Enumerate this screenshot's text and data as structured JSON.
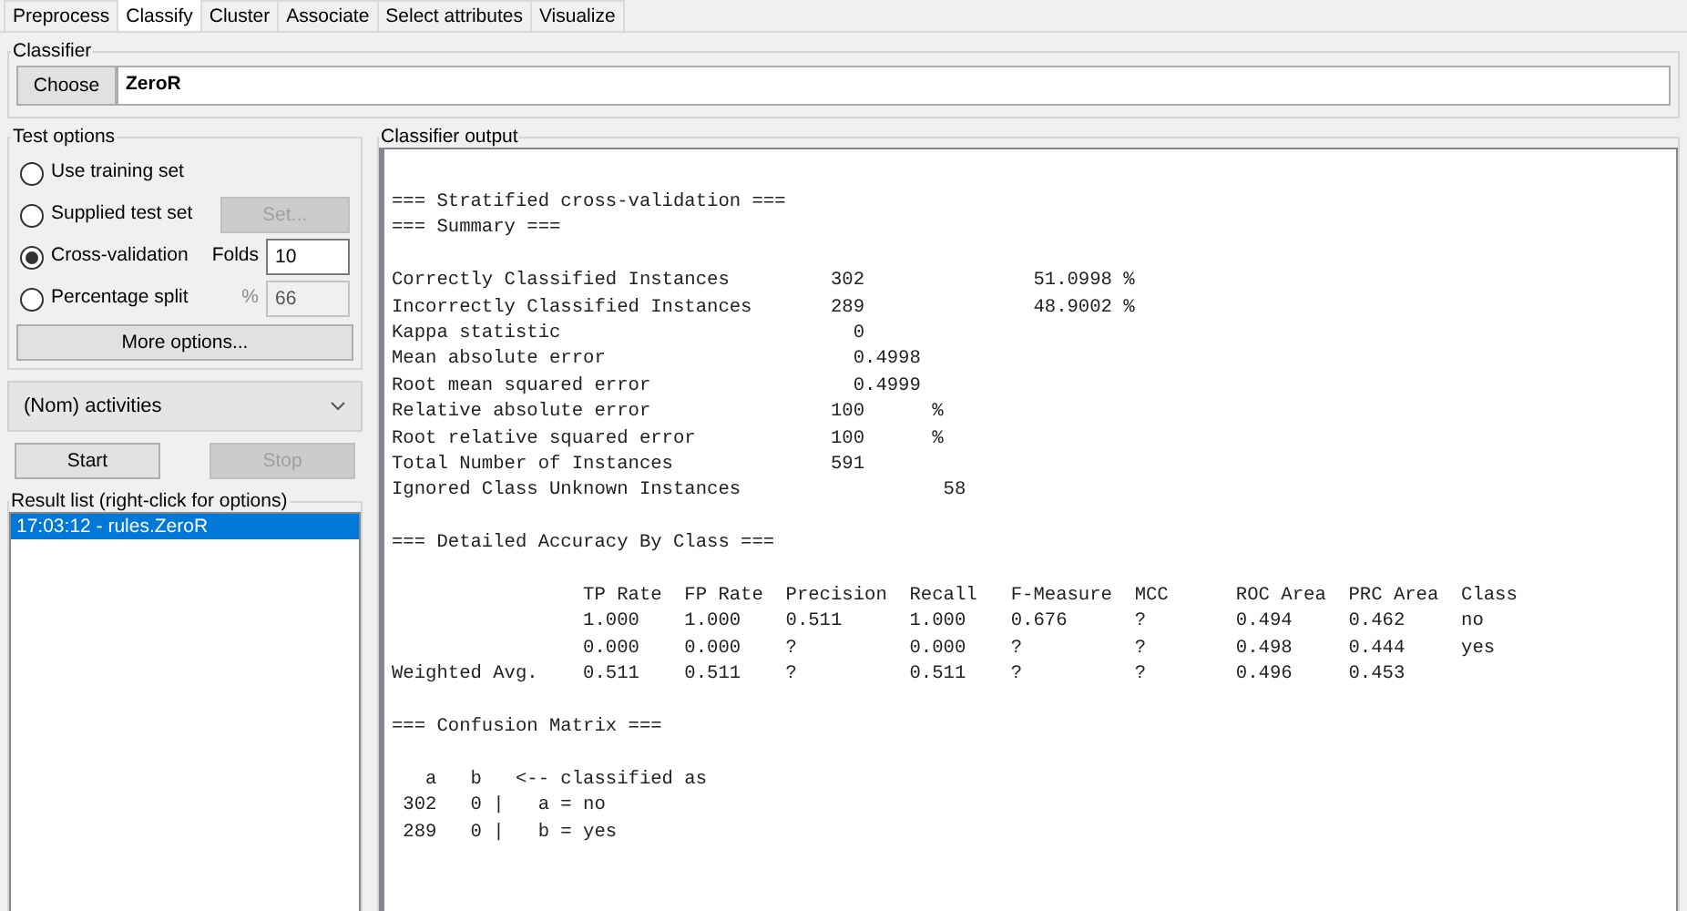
{
  "tabs": [
    {
      "label": "Preprocess",
      "selected": false
    },
    {
      "label": "Classify",
      "selected": true
    },
    {
      "label": "Cluster",
      "selected": false
    },
    {
      "label": "Associate",
      "selected": false
    },
    {
      "label": "Select attributes",
      "selected": false
    },
    {
      "label": "Visualize",
      "selected": false
    }
  ],
  "classifier": {
    "title": "Classifier",
    "button": "Choose",
    "value": "ZeroR"
  },
  "test_options": {
    "title": "Test options",
    "options": [
      {
        "label": "Use training set",
        "selected": false,
        "kind": "plain"
      },
      {
        "label": "Supplied test set",
        "selected": false,
        "kind": "button",
        "button": "Set...",
        "disabled": true
      },
      {
        "label": "Cross-validation",
        "selected": true,
        "kind": "field",
        "field_label": "Folds",
        "value": "10",
        "disabled": false
      },
      {
        "label": "Percentage split",
        "selected": false,
        "kind": "field",
        "field_label": "%",
        "value": "66",
        "disabled": true
      }
    ],
    "more_button": "More options..."
  },
  "class_attribute": {
    "value": "(Nom) activities"
  },
  "run_buttons": [
    {
      "label": "Start",
      "disabled": false
    },
    {
      "label": "Stop",
      "disabled": true
    }
  ],
  "result_list": {
    "title": "Result list (right-click for options)",
    "items": [
      {
        "label": "17:03:12 - rules.ZeroR",
        "selected": true
      }
    ]
  },
  "output": {
    "title": "Classifier output",
    "blocks": [
      {
        "lines": [
          "=== Stratified cross-validation ===",
          "=== Summary ==="
        ]
      },
      {
        "lines": [
          "Correctly Classified Instances         302               51.0998 %",
          "Incorrectly Classified Instances       289               48.9002 %",
          "Kappa statistic                          0",
          "Mean absolute error                      0.4998",
          "Root mean squared error                  0.4999",
          "Relative absolute error                100      %",
          "Root relative squared error            100      %",
          "Total Number of Instances              591",
          "Ignored Class Unknown Instances                  58"
        ]
      },
      {
        "lines": [
          "=== Detailed Accuracy By Class ==="
        ]
      },
      {
        "lines": [
          "                 TP Rate  FP Rate  Precision  Recall   F-Measure  MCC      ROC Area  PRC Area  Class",
          "                 1.000    1.000    0.511      1.000    0.676      ?        0.494     0.462     no",
          "                 0.000    0.000    ?          0.000    ?          ?        0.498     0.444     yes",
          "Weighted Avg.    0.511    0.511    ?          0.511    ?          ?        0.496     0.453"
        ]
      },
      {
        "lines": [
          "=== Confusion Matrix ==="
        ]
      },
      {
        "lines": [
          "   a   b   <-- classified as",
          " 302   0 |   a = no",
          " 289   0 |   b = yes"
        ]
      }
    ]
  }
}
